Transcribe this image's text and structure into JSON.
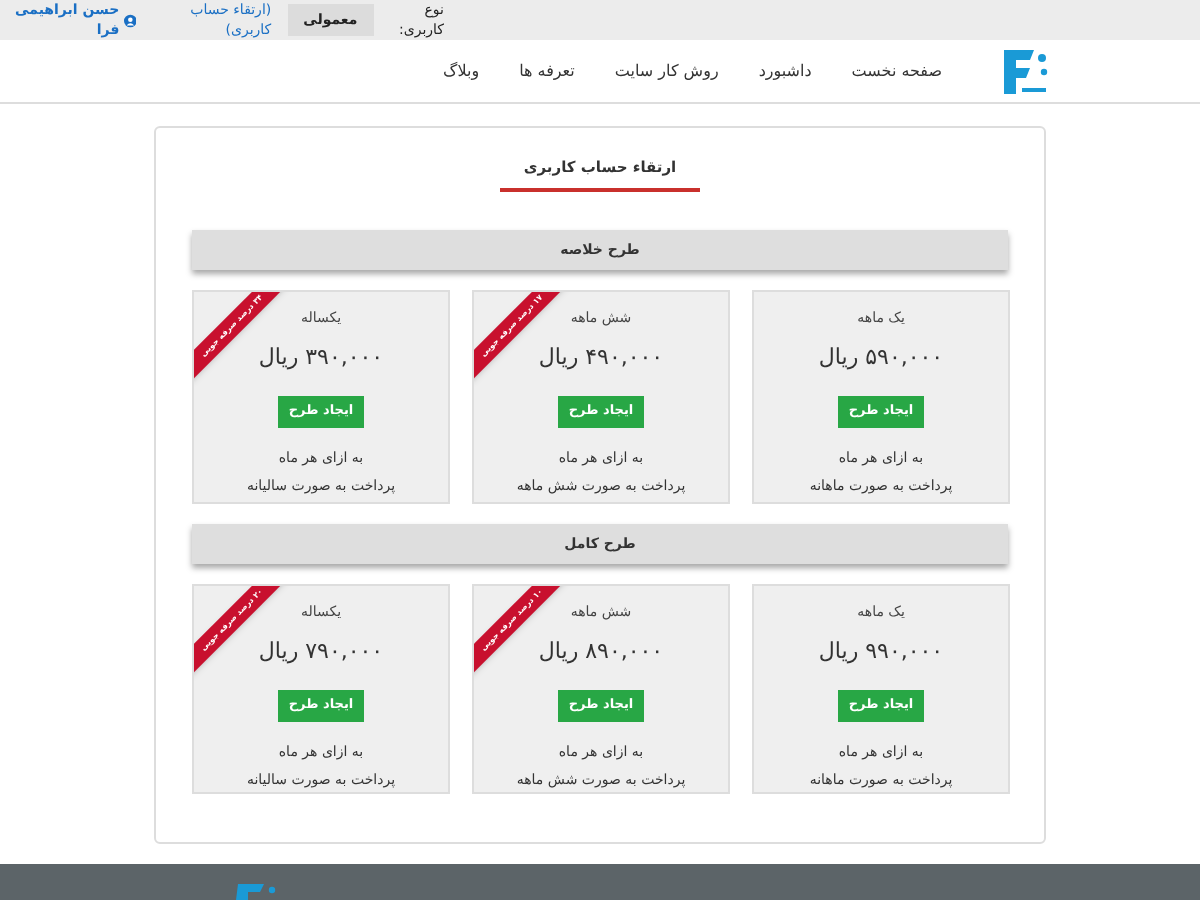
{
  "top_bar": {
    "user_type_label": "نوع کاربری:",
    "user_type": "معمولی",
    "upgrade_link": "(ارتقاء حساب کاربری)",
    "user_name": "حسن ابراهیمی فرا"
  },
  "nav": [
    {
      "label": "صفحه نخست"
    },
    {
      "label": "داشبورد"
    },
    {
      "label": "روش کار سایت"
    },
    {
      "label": "تعرفه ها"
    },
    {
      "label": "وبلاگ"
    }
  ],
  "page_title": "ارتقاء حساب کاربری",
  "sections": [
    {
      "title": "طرح خلاصه",
      "plans": [
        {
          "period": "یک ماهه",
          "price": "۵۹۰,۰۰۰ ریال",
          "button": "ایجاد طرح",
          "note": "به ازای هر ماه",
          "payment": "پرداخت به صورت ماهانه"
        },
        {
          "period": "شش ماهه",
          "price": "۴۹۰,۰۰۰ ریال",
          "button": "ایجاد طرح",
          "note": "به ازای هر ماه",
          "payment": "پرداخت به صورت شش ماهه",
          "ribbon": "۱۷ درصد صرفه جویی"
        },
        {
          "period": "یکساله",
          "price": "۳۹۰,۰۰۰ ریال",
          "button": "ایجاد طرح",
          "note": "به ازای هر ماه",
          "payment": "پرداخت به صورت سالیانه",
          "ribbon": "۳۴ درصد صرفه جویی"
        }
      ]
    },
    {
      "title": "طرح کامل",
      "plans": [
        {
          "period": "یک ماهه",
          "price": "۹۹۰,۰۰۰ ریال",
          "button": "ایجاد طرح",
          "note": "به ازای هر ماه",
          "payment": "پرداخت به صورت ماهانه"
        },
        {
          "period": "شش ماهه",
          "price": "۸۹۰,۰۰۰ ریال",
          "button": "ایجاد طرح",
          "note": "به ازای هر ماه",
          "payment": "پرداخت به صورت شش ماهه",
          "ribbon": "۱۰ درصد صرفه جویی"
        },
        {
          "period": "یکساله",
          "price": "۷۹۰,۰۰۰ ریال",
          "button": "ایجاد طرح",
          "note": "به ازای هر ماه",
          "payment": "پرداخت به صورت سالیانه",
          "ribbon": "۲۰ درصد صرفه جویی"
        }
      ]
    }
  ]
}
